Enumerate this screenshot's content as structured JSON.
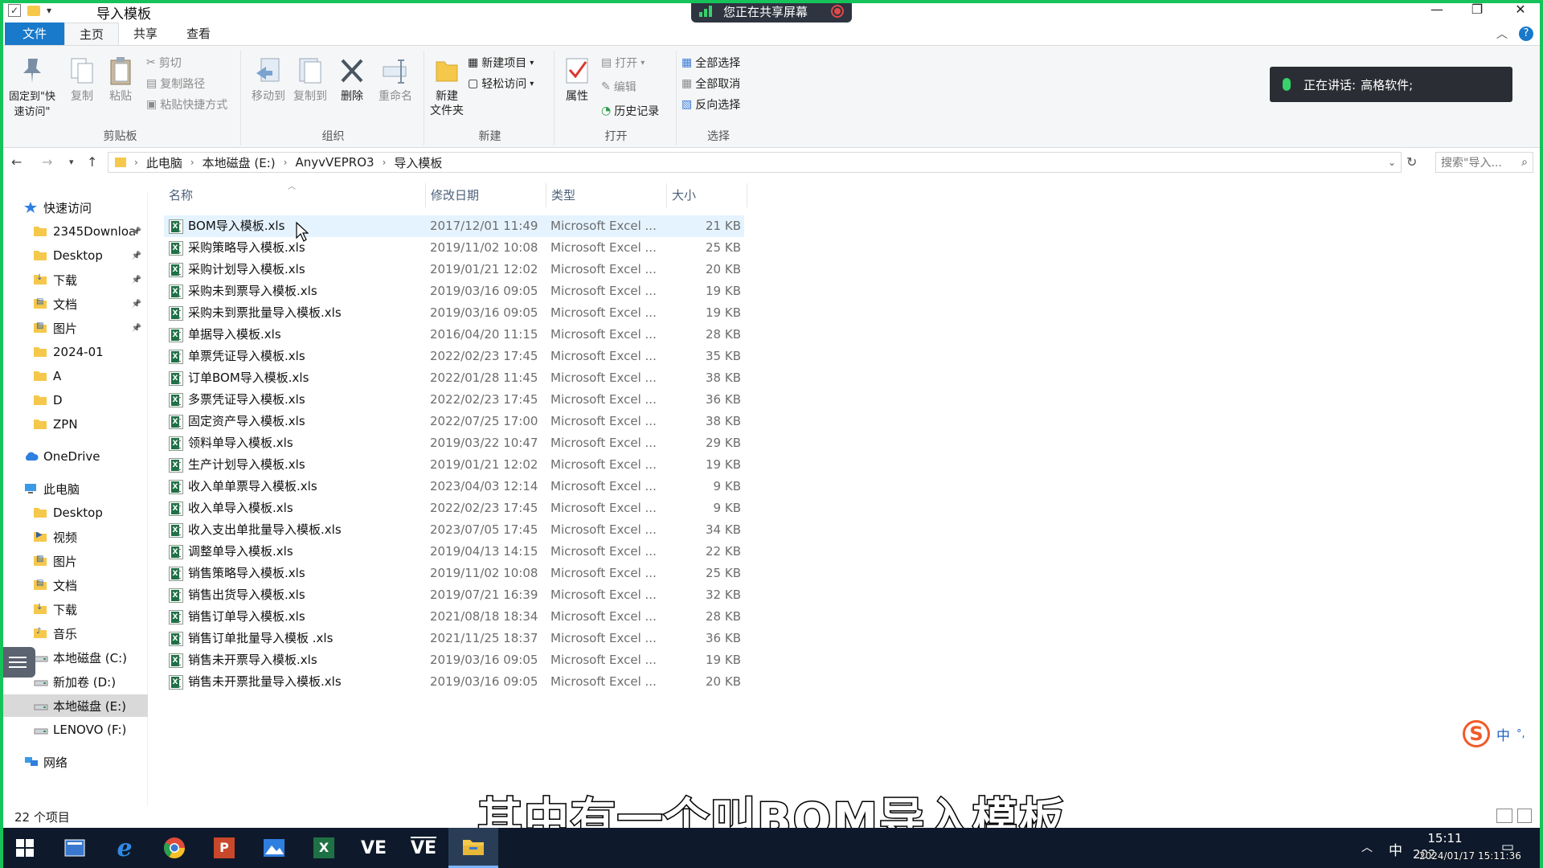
{
  "window": {
    "title": "导入模板",
    "share_banner": "您正在共享屏幕",
    "speaking_label": "正在讲话:",
    "speaking_name": "高格软件;"
  },
  "tabs": [
    "文件",
    "主页",
    "共享",
    "查看"
  ],
  "ribbon": {
    "clipboard": {
      "label": "剪贴板",
      "pin": "固定到\"快速访问\"",
      "copy": "复制",
      "paste": "粘贴",
      "cut": "剪切",
      "copy_path": "复制路径",
      "paste_shortcut": "粘贴快捷方式"
    },
    "organize": {
      "label": "组织",
      "move_to": "移动到",
      "copy_to": "复制到",
      "delete": "删除",
      "rename": "重命名"
    },
    "new": {
      "label": "新建",
      "new_folder": "新建\n文件夹",
      "new_item": "新建项目",
      "easy_access": "轻松访问"
    },
    "open": {
      "label": "打开",
      "properties": "属性",
      "open": "打开",
      "edit": "编辑",
      "history": "历史记录"
    },
    "select": {
      "label": "选择",
      "select_all": "全部选择",
      "select_none": "全部取消",
      "invert": "反向选择"
    }
  },
  "address": {
    "crumbs": [
      "此电脑",
      "本地磁盘 (E:)",
      "AnyvVEPRO3",
      "导入模板"
    ],
    "search_placeholder": "搜索\"导入..."
  },
  "nav_pane": [
    {
      "label": "快速访问",
      "icon": "star-icon",
      "pinned": false
    },
    {
      "label": "2345Downloa",
      "icon": "folder-icon",
      "pinned": true
    },
    {
      "label": "Desktop",
      "icon": "folder-icon",
      "pinned": true
    },
    {
      "label": "下载",
      "icon": "download-folder-icon",
      "pinned": true
    },
    {
      "label": "文档",
      "icon": "document-folder-icon",
      "pinned": true
    },
    {
      "label": "图片",
      "icon": "pictures-folder-icon",
      "pinned": true
    },
    {
      "label": "2024-01",
      "icon": "folder-icon",
      "pinned": false
    },
    {
      "label": "A",
      "icon": "folder-icon",
      "pinned": false
    },
    {
      "label": "D",
      "icon": "folder-icon",
      "pinned": false
    },
    {
      "label": "ZPN",
      "icon": "folder-icon",
      "pinned": false
    },
    {
      "label": "OneDrive",
      "icon": "cloud-icon",
      "pinned": false
    },
    {
      "label": "此电脑",
      "icon": "computer-icon",
      "pinned": false
    },
    {
      "label": "Desktop",
      "icon": "folder-icon",
      "pinned": false
    },
    {
      "label": "视频",
      "icon": "video-folder-icon",
      "pinned": false
    },
    {
      "label": "图片",
      "icon": "pictures-folder-icon",
      "pinned": false
    },
    {
      "label": "文档",
      "icon": "document-folder-icon",
      "pinned": false
    },
    {
      "label": "下载",
      "icon": "download-folder-icon",
      "pinned": false
    },
    {
      "label": "音乐",
      "icon": "music-folder-icon",
      "pinned": false
    },
    {
      "label": "本地磁盘 (C:)",
      "icon": "drive-icon",
      "pinned": false
    },
    {
      "label": "新加卷 (D:)",
      "icon": "drive-icon",
      "pinned": false
    },
    {
      "label": "本地磁盘 (E:)",
      "icon": "drive-icon",
      "pinned": false,
      "selected": true
    },
    {
      "label": "LENOVO (F:)",
      "icon": "drive-icon",
      "pinned": false
    },
    {
      "label": "网络",
      "icon": "network-icon",
      "pinned": false
    }
  ],
  "columns": {
    "name": "名称",
    "date": "修改日期",
    "type": "类型",
    "size": "大小"
  },
  "files": [
    {
      "name": "BOM导入模板.xls",
      "date": "2017/12/01 11:49",
      "type": "Microsoft Excel ...",
      "size": "21 KB"
    },
    {
      "name": "采购策略导入模板.xls",
      "date": "2019/11/02 10:08",
      "type": "Microsoft Excel ...",
      "size": "25 KB"
    },
    {
      "name": "采购计划导入模板.xls",
      "date": "2019/01/21 12:02",
      "type": "Microsoft Excel ...",
      "size": "20 KB"
    },
    {
      "name": "采购未到票导入模板.xls",
      "date": "2019/03/16 09:05",
      "type": "Microsoft Excel ...",
      "size": "19 KB"
    },
    {
      "name": "采购未到票批量导入模板.xls",
      "date": "2019/03/16 09:05",
      "type": "Microsoft Excel ...",
      "size": "19 KB"
    },
    {
      "name": "单据导入模板.xls",
      "date": "2016/04/20 11:15",
      "type": "Microsoft Excel ...",
      "size": "28 KB"
    },
    {
      "name": "单票凭证导入模板.xls",
      "date": "2022/02/23 17:45",
      "type": "Microsoft Excel ...",
      "size": "35 KB"
    },
    {
      "name": "订单BOM导入模板.xls",
      "date": "2022/01/28 11:45",
      "type": "Microsoft Excel ...",
      "size": "38 KB"
    },
    {
      "name": "多票凭证导入模板.xls",
      "date": "2022/02/23 17:45",
      "type": "Microsoft Excel ...",
      "size": "36 KB"
    },
    {
      "name": "固定资产导入模板.xls",
      "date": "2022/07/25 17:00",
      "type": "Microsoft Excel ...",
      "size": "38 KB"
    },
    {
      "name": "领料单导入模板.xls",
      "date": "2019/03/22 10:47",
      "type": "Microsoft Excel ...",
      "size": "29 KB"
    },
    {
      "name": "生产计划导入模板.xls",
      "date": "2019/01/21 12:02",
      "type": "Microsoft Excel ...",
      "size": "19 KB"
    },
    {
      "name": "收入单单票导入模板.xls",
      "date": "2023/04/03 12:14",
      "type": "Microsoft Excel ...",
      "size": "9 KB"
    },
    {
      "name": "收入单导入模板.xls",
      "date": "2022/02/23 17:45",
      "type": "Microsoft Excel ...",
      "size": "9 KB"
    },
    {
      "name": "收入支出单批量导入模板.xls",
      "date": "2023/07/05 17:45",
      "type": "Microsoft Excel ...",
      "size": "34 KB"
    },
    {
      "name": "调整单导入模板.xls",
      "date": "2019/04/13 14:15",
      "type": "Microsoft Excel ...",
      "size": "22 KB"
    },
    {
      "name": "销售策略导入模板.xls",
      "date": "2019/11/02 10:08",
      "type": "Microsoft Excel ...",
      "size": "25 KB"
    },
    {
      "name": "销售出货导入模板.xls",
      "date": "2019/07/21 16:39",
      "type": "Microsoft Excel ...",
      "size": "32 KB"
    },
    {
      "name": "销售订单导入模板.xls",
      "date": "2021/08/18 18:34",
      "type": "Microsoft Excel ...",
      "size": "28 KB"
    },
    {
      "name": "销售订单批量导入模板 .xls",
      "date": "2021/11/25 18:37",
      "type": "Microsoft Excel ...",
      "size": "36 KB"
    },
    {
      "name": "销售未开票导入模板.xls",
      "date": "2019/03/16 09:05",
      "type": "Microsoft Excel ...",
      "size": "19 KB"
    },
    {
      "name": "销售未开票批量导入模板.xls",
      "date": "2019/03/16 09:05",
      "type": "Microsoft Excel ...",
      "size": "20 KB"
    }
  ],
  "status": {
    "item_count": "22 个项目"
  },
  "subtitle": "其中有一个叫BOM导入模板",
  "taskbar": {
    "ime_label": "中",
    "time": "15:11",
    "date": "202",
    "timestamp": "2024/01/17 15:11:36",
    "apps": [
      "start-icon",
      "task-view-icon",
      "ie-icon",
      "chrome-icon",
      "powerpoint-icon",
      "photos-icon",
      "excel-icon",
      "ve-app-icon",
      "ve-app-icon-2",
      "file-explorer-icon"
    ]
  },
  "ime": {
    "lang": "中",
    "punct": "°,"
  },
  "colors": {
    "accent": "#1979ca",
    "share_green": "#16c35a",
    "excel_green": "#1e7145",
    "hover": "#e5f3ff"
  }
}
